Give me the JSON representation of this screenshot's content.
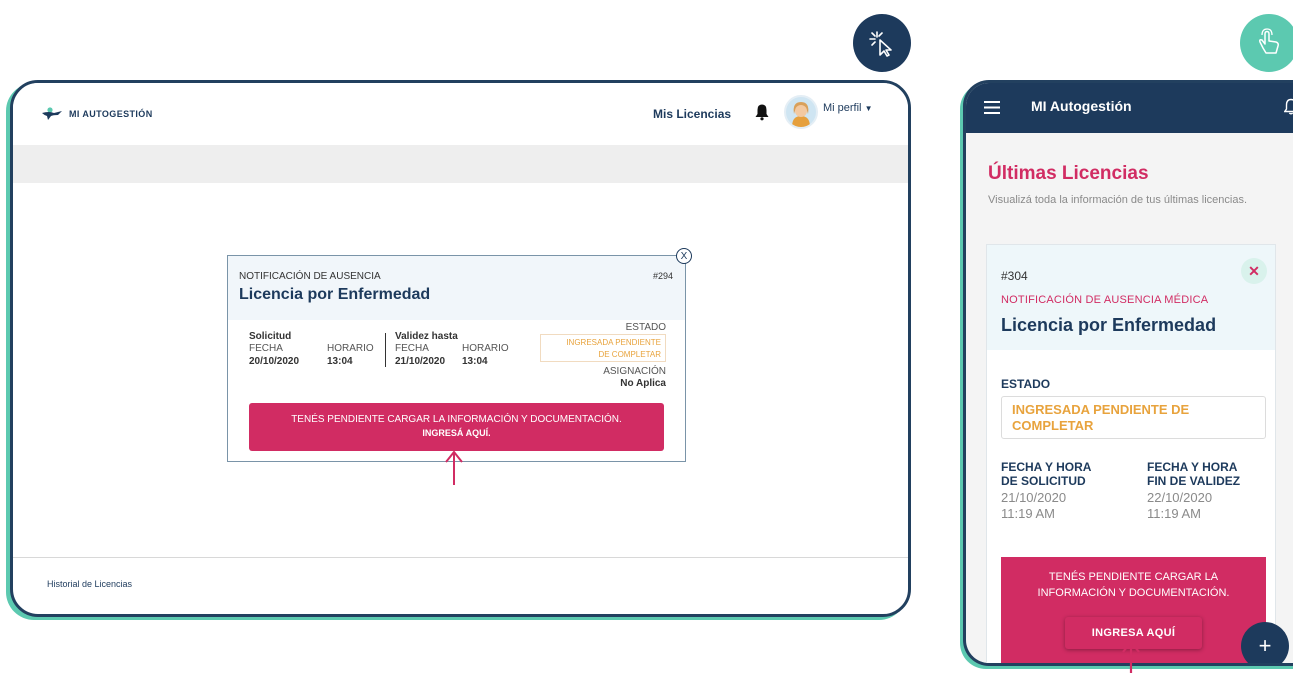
{
  "desktop": {
    "logo_text": "MI AUTOGESTIÓN",
    "nav_link": "Mis Licencias",
    "profile_label": "Mi perfil",
    "footer_link": "Historial de Licencias",
    "modal": {
      "subtitle": "NOTIFICACIÓN DE AUSENCIA",
      "number": "#294",
      "title": "Licencia por Enfermedad",
      "close_label": "X",
      "solicitud_label": "Solicitud",
      "validez_label": "Validez hasta",
      "fecha_label": "FECHA",
      "horario_label": "HORARIO",
      "solicitud_fecha": "20/10/2020",
      "solicitud_hora": "13:04",
      "validez_fecha": "21/10/2020",
      "validez_hora": "13:04",
      "estado_label": "ESTADO",
      "estado_value_1": "INGRESADA PENDIENTE",
      "estado_value_2": "DE COMPLETAR",
      "asignacion_label": "ASIGNACIÓN",
      "asignacion_value": "No Aplica",
      "cta_line1": "TENÉS PENDIENTE CARGAR LA INFORMACIÓN Y DOCUMENTACIÓN.",
      "cta_line2": "INGRESÁ AQUÍ."
    }
  },
  "mobile": {
    "app_title": "MI Autogestión",
    "heading": "Últimas Licencias",
    "description": "Visualizá toda la información de tus últimas licencias.",
    "card": {
      "number": "#304",
      "subtitle": "NOTIFICACIÓN DE AUSENCIA MÉDICA",
      "title": "Licencia por Enfermedad",
      "estado_label": "ESTADO",
      "estado_value": "INGRESADA PENDIENTE DE COMPLETAR",
      "solicitud_label_1": "FECHA Y HORA",
      "solicitud_label_2": "DE SOLICITUD",
      "solicitud_fecha": "21/10/2020",
      "solicitud_hora": "11:19 AM",
      "validez_label_1": "FECHA Y HORA",
      "validez_label_2": "FIN DE VALIDEZ",
      "validez_fecha": "22/10/2020",
      "validez_hora": "11:19 AM",
      "cta_text": "TENÉS PENDIENTE CARGAR LA INFORMACIÓN Y DOCUMENTACIÓN.",
      "cta_button": "INGRESA AQUÍ"
    },
    "fab_label": "+"
  },
  "colors": {
    "navy": "#1d3a5c",
    "teal": "#5cc9b0",
    "pink": "#d12c63",
    "amber": "#e8a33d"
  },
  "icons": [
    "click-cursor-icon",
    "touch-hand-icon",
    "logo-icon",
    "bell-icon",
    "avatar-icon",
    "caret-down-icon",
    "menu-icon",
    "up-arrow-icon",
    "close-icon",
    "plus-icon"
  ]
}
